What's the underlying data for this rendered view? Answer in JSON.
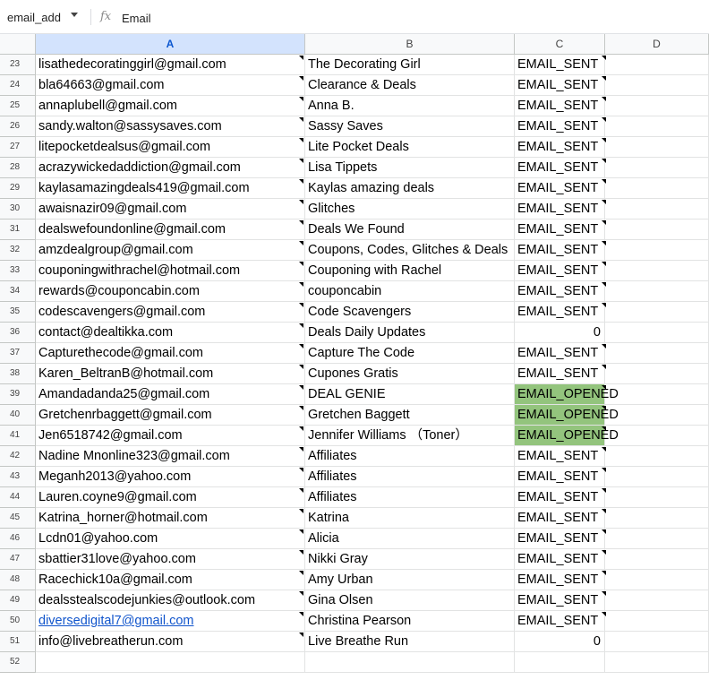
{
  "formula_bar": {
    "name_box": "email_add",
    "fx_icon": "fx",
    "content": "Email"
  },
  "columns": [
    {
      "label": "A",
      "selected": true
    },
    {
      "label": "B",
      "selected": false
    },
    {
      "label": "C",
      "selected": false
    },
    {
      "label": "D",
      "selected": false
    }
  ],
  "rows": [
    {
      "num": "23",
      "a": "lisathedecoratinggirl@gmail.com",
      "b": "The Decorating Girl",
      "c": "EMAIL_SENT"
    },
    {
      "num": "24",
      "a": "bla64663@gmail.com",
      "b": "Clearance & Deals",
      "c": "EMAIL_SENT"
    },
    {
      "num": "25",
      "a": "annaplubell@gmail.com",
      "b": "Anna B.",
      "c": "EMAIL_SENT"
    },
    {
      "num": "26",
      "a": "sandy.walton@sassysaves.com",
      "b": "Sassy Saves",
      "c": "EMAIL_SENT"
    },
    {
      "num": "27",
      "a": "litepocketdealsus@gmail.com",
      "b": "Lite Pocket Deals",
      "c": "EMAIL_SENT"
    },
    {
      "num": "28",
      "a": "acrazywickedaddiction@gmail.com",
      "b": "Lisa Tippets",
      "c": "EMAIL_SENT"
    },
    {
      "num": "29",
      "a": "kaylasamazingdeals419@gmail.com",
      "b": "Kaylas amazing deals",
      "c": "EMAIL_SENT"
    },
    {
      "num": "30",
      "a": "awaisnazir09@gmail.com",
      "b": "Glitches",
      "c": "EMAIL_SENT"
    },
    {
      "num": "31",
      "a": "dealswefoundonline@gmail.com",
      "b": "Deals We Found",
      "c": "EMAIL_SENT"
    },
    {
      "num": "32",
      "a": "amzdealgroup@gmail.com",
      "b": "Coupons, Codes, Glitches & Deals",
      "c": "EMAIL_SENT"
    },
    {
      "num": "33",
      "a": "couponingwithrachel@hotmail.com",
      "b": "Couponing with Rachel",
      "c": "EMAIL_SENT"
    },
    {
      "num": "34",
      "a": "rewards@couponcabin.com",
      "b": "couponcabin",
      "c": "EMAIL_SENT"
    },
    {
      "num": "35",
      "a": "codescavengers@gmail.com",
      "b": "Code Scavengers",
      "c": "EMAIL_SENT"
    },
    {
      "num": "36",
      "a": "contact@dealtikka.com",
      "b": "Deals Daily Updates",
      "c": "0",
      "c_numeric": true
    },
    {
      "num": "37",
      "a": "Capturethecode@gmail.com",
      "b": "Capture The Code",
      "c": "EMAIL_SENT"
    },
    {
      "num": "38",
      "a": "Karen_BeltranB@hotmail.com",
      "b": "Cupones Gratis",
      "c": "EMAIL_SENT"
    },
    {
      "num": "39",
      "a": "Amandadanda25@gmail.com",
      "b": "DEAL GENIE",
      "c": "EMAIL_OPENED",
      "opened": true
    },
    {
      "num": "40",
      "a": "Gretchenrbaggett@gmail.com",
      "b": "Gretchen Baggett",
      "c": "EMAIL_OPENED",
      "opened": true
    },
    {
      "num": "41",
      "a": "Jen6518742@gmail.com",
      "b": "Jennifer Williams （Toner）",
      "c": "EMAIL_OPENED",
      "opened": true
    },
    {
      "num": "42",
      "a": "Nadine Mnonline323@gmail.com",
      "b": "Affiliates",
      "c": "EMAIL_SENT"
    },
    {
      "num": "43",
      "a": "Meganh2013@yahoo.com",
      "b": "Affiliates",
      "c": "EMAIL_SENT"
    },
    {
      "num": "44",
      "a": "Lauren.coyne9@gmail.com",
      "b": "Affiliates",
      "c": "EMAIL_SENT"
    },
    {
      "num": "45",
      "a": "Katrina_horner@hotmail.com",
      "b": "Katrina",
      "c": "EMAIL_SENT"
    },
    {
      "num": "46",
      "a": "Lcdn01@yahoo.com",
      "b": "Alicia",
      "c": "EMAIL_SENT"
    },
    {
      "num": "47",
      "a": "sbattier31love@yahoo.com",
      "b": "Nikki Gray",
      "c": "EMAIL_SENT"
    },
    {
      "num": "48",
      "a": "Racechick10a@gmail.com",
      "b": "Amy Urban",
      "c": "EMAIL_SENT"
    },
    {
      "num": "49",
      "a": "dealssteal­scodejunkies@outlook.com",
      "b": "Gina Olsen",
      "c": "EMAIL_SENT"
    },
    {
      "num": "50",
      "a": "diversedigital7@gmail.com",
      "b": "Christina Pearson",
      "c": "EMAIL_SENT",
      "a_link": true
    },
    {
      "num": "51",
      "a": "info@livebreatherun.com",
      "b": "Live Breathe Run",
      "c": "0",
      "c_numeric": true
    },
    {
      "num": "52",
      "a": "",
      "b": "",
      "c": ""
    }
  ],
  "colors": {
    "opened_fill": "#93c47d",
    "link": "#1155cc",
    "selected_header": "#d3e3fd"
  }
}
